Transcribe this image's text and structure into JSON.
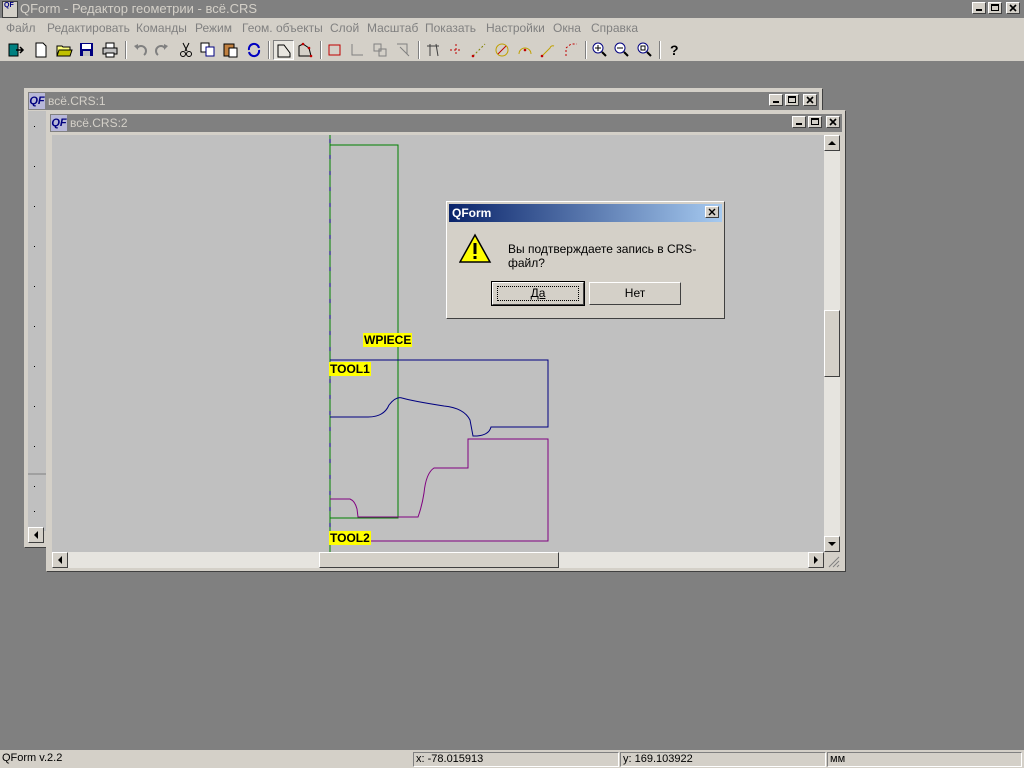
{
  "app": {
    "title": "QForm - Редактор геометрии  - всё.CRS",
    "icon_text": "QF"
  },
  "menu": [
    "Файл",
    "Редактировать",
    "Команды",
    "Режим",
    "Геом. объекты",
    "Слой",
    "Масштаб",
    "Показать",
    "Настройки",
    "Окна",
    "Справка"
  ],
  "toolbar": {
    "icons": [
      "exit-icon",
      "new-file-icon",
      "open-folder-icon",
      "save-icon",
      "print-icon",
      "undo-icon",
      "redo-icon",
      "cut-icon",
      "copy-icon",
      "paste-icon",
      "refresh-icon",
      "select-mode-icon",
      "polygon-mode-icon",
      "rectangle-icon",
      "polyline-icon",
      "group-icon",
      "arrow-tool-icon",
      "trim-icon",
      "dotted-line-icon",
      "dotted-segment-icon",
      "circle-icon",
      "arc-icon",
      "fillet-icon",
      "chamfer-icon",
      "zoom-in-icon",
      "zoom-out-icon",
      "zoom-fit-icon",
      "help-icon"
    ]
  },
  "windows": [
    {
      "title": "всё.CRS:1",
      "icon_text": "QF"
    },
    {
      "title": "всё.CRS:2",
      "icon_text": "QF"
    }
  ],
  "canvas": {
    "labels": {
      "wpiece": "WPIECE",
      "tool1": "TOOL1",
      "tool2": "TOOL2"
    },
    "colors": {
      "wpiece": "#008000",
      "tool1": "#000080",
      "tool2": "#800080",
      "label_bg": "#ffff00",
      "background": "#c0c0c0"
    }
  },
  "dialog": {
    "title": "QForm",
    "message": "Вы подтверждаете запись в CRS-файл?",
    "icon": "warning-icon",
    "yes_label": "Да",
    "no_label": "Нет"
  },
  "status": {
    "version": "QForm v.2.2",
    "x": "x: -78.015913",
    "y": "y: 169.103922",
    "units": "мм"
  }
}
